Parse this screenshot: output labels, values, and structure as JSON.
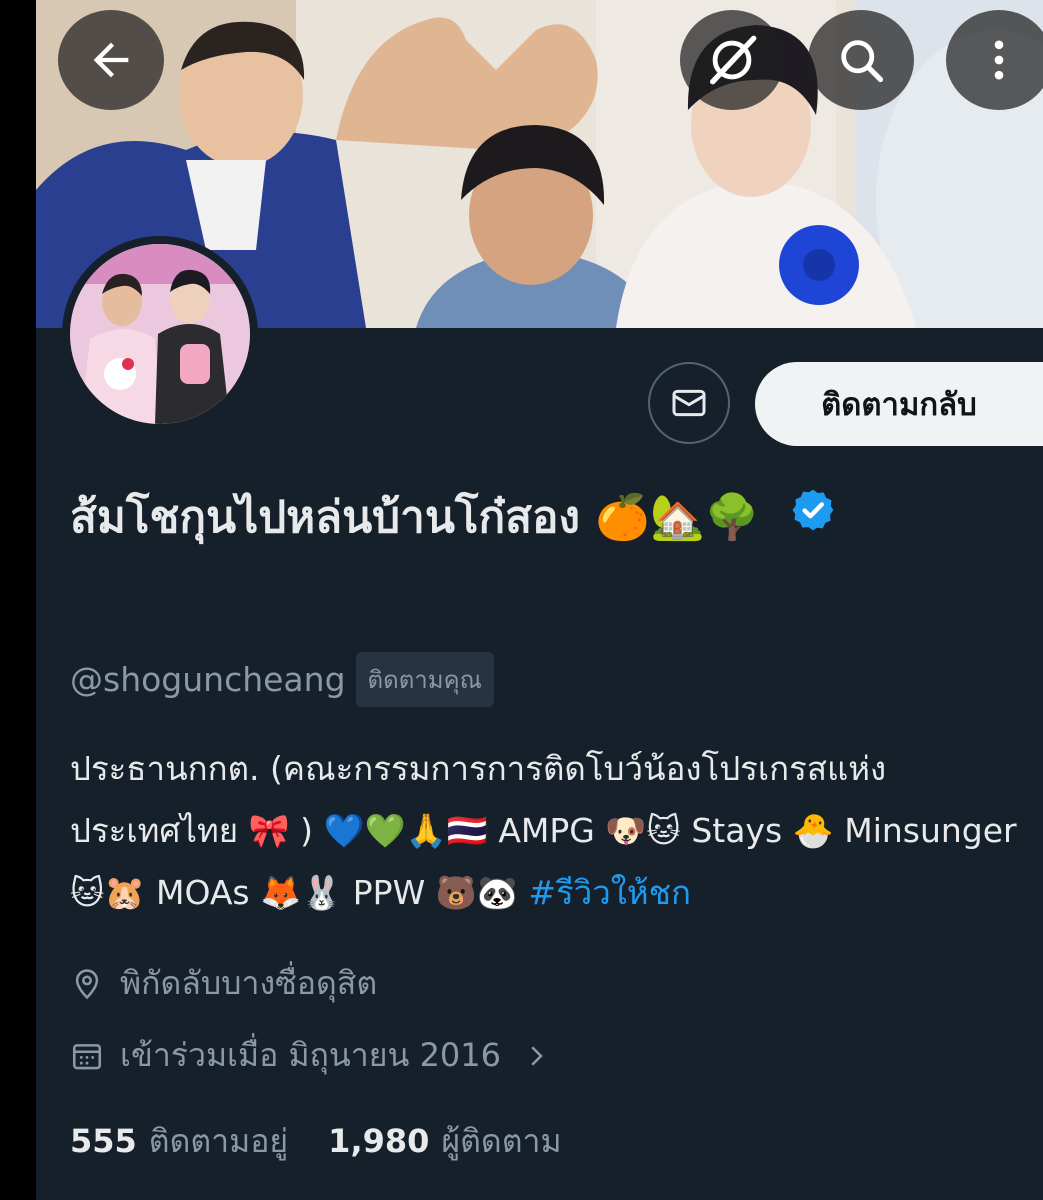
{
  "profile": {
    "display_name": "ส้มโชกุนไปหล่นบ้านโก๋สอง 🍊🏡🌳",
    "handle": "@shoguncheang",
    "follows_you_badge": "ติดตามคุณ",
    "bio_text": "ประธานกกต. (คณะกรรมการการติดโบว์น้องโปรเกรสแห่งประเทศไทย 🎀 ) 💙💚🙏🇹🇭 AMPG 🐶🐱 Stays 🐣 Minsunger 🐱🐹 MOAs 🦊🐰 PPW 🐻🐼 ",
    "bio_hashtag": "#รีวิวให้ชก",
    "location": "พิกัดลับบางซื่อดุสิต",
    "joined": "เข้าร่วมเมื่อ มิถุนายน 2016",
    "following_count": "555",
    "following_label": "ติดตามอยู่",
    "followers_count": "1,980",
    "followers_label": "ผู้ติดตาม"
  },
  "actions": {
    "follow_back_label": "ติดตามกลับ"
  },
  "icons": {
    "back": "arrow-left-icon",
    "grok": "grok-icon",
    "search": "search-icon",
    "more": "more-vertical-icon",
    "message": "envelope-icon",
    "verified": "verified-badge-icon",
    "location": "location-pin-icon",
    "calendar": "calendar-icon",
    "chevron": "chevron-right-icon"
  },
  "colors": {
    "background": "#15202b",
    "text_primary": "#e7e9ea",
    "text_secondary": "#8b98a5",
    "link": "#1d9bf0",
    "verified": "#1d9bf0",
    "follow_button_bg": "#eff3f4"
  }
}
